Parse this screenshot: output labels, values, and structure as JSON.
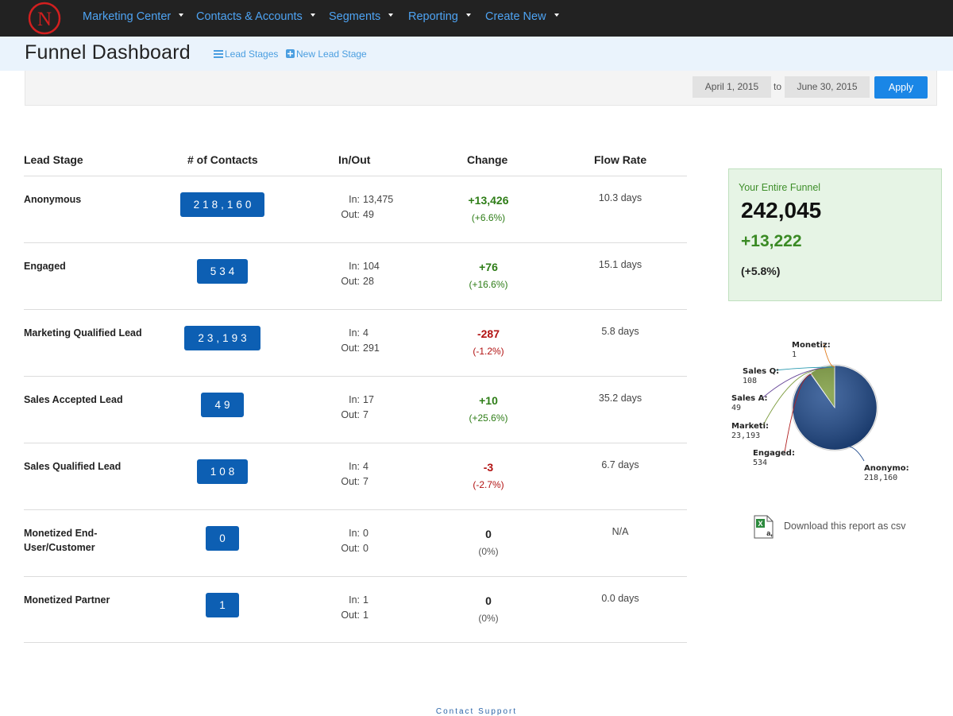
{
  "nav": {
    "logo_letter": "N",
    "items": [
      {
        "label": "Marketing Center"
      },
      {
        "label": "Contacts & Accounts"
      },
      {
        "label": "Segments"
      },
      {
        "label": "Reporting"
      },
      {
        "label": "Create New"
      }
    ]
  },
  "header": {
    "title": "Funnel Dashboard",
    "lead_stages_link": "Lead Stages",
    "new_lead_stage_link": "New Lead Stage"
  },
  "filter": {
    "start_date": "April 1, 2015",
    "to_label": "to",
    "end_date": "June 30, 2015",
    "apply_label": "Apply"
  },
  "table": {
    "headers": [
      "Lead Stage",
      "# of Contacts",
      "In/Out",
      "Change",
      "Flow Rate"
    ],
    "in_label": "In:",
    "out_label": "Out:",
    "rows": [
      {
        "stage": "Anonymous",
        "contacts": "218,160",
        "in": "13,475",
        "out": "49",
        "change": "+13,426",
        "change_pct": "(+6.6%)",
        "flow": "10.3 days",
        "trend": "pos"
      },
      {
        "stage": "Engaged",
        "contacts": "534",
        "in": "104",
        "out": "28",
        "change": "+76",
        "change_pct": "(+16.6%)",
        "flow": "15.1 days",
        "trend": "pos"
      },
      {
        "stage": "Marketing Qualified Lead",
        "contacts": "23,193",
        "in": "4",
        "out": "291",
        "change": "-287",
        "change_pct": "(-1.2%)",
        "flow": "5.8 days",
        "trend": "neg"
      },
      {
        "stage": "Sales Accepted Lead",
        "contacts": "49",
        "in": "17",
        "out": "7",
        "change": "+10",
        "change_pct": "(+25.6%)",
        "flow": "35.2 days",
        "trend": "pos"
      },
      {
        "stage": "Sales Qualified Lead",
        "contacts": "108",
        "in": "4",
        "out": "7",
        "change": "-3",
        "change_pct": "(-2.7%)",
        "flow": "6.7 days",
        "trend": "neg"
      },
      {
        "stage": "Monetized End-User/Customer",
        "contacts": "0",
        "in": "0",
        "out": "0",
        "change": "0",
        "change_pct": "(0%)",
        "flow": "N/A",
        "trend": "neu"
      },
      {
        "stage": "Monetized Partner",
        "contacts": "1",
        "in": "1",
        "out": "1",
        "change": "0",
        "change_pct": "(0%)",
        "flow": "0.0 days",
        "trend": "neu"
      }
    ]
  },
  "summary": {
    "label": "Your Entire Funnel",
    "total": "242,045",
    "change": "+13,222",
    "change_pct": "(+5.8%)"
  },
  "chart_data": {
    "type": "pie",
    "slices": [
      {
        "label": "Anonymo:",
        "value": 218160,
        "value_label": "218,160",
        "color": "#1f4a8c"
      },
      {
        "label": "Engaged:",
        "value": 534,
        "value_label": "534",
        "color": "#b01e1e"
      },
      {
        "label": "Marketi:",
        "value": 23193,
        "value_label": "23,193",
        "color": "#7a9a3a"
      },
      {
        "label": "Sales A:",
        "value": 49,
        "value_label": "49",
        "color": "#6a4a9a"
      },
      {
        "label": "Sales Q:",
        "value": 108,
        "value_label": "108",
        "color": "#2a9ab0"
      },
      {
        "label": "Monetiz:",
        "value": 1,
        "value_label": "1",
        "color": "#e07a1a"
      }
    ]
  },
  "download": {
    "label": "Download this report as csv"
  },
  "footer": {
    "contact_label": "Contact Support"
  },
  "colors": {
    "nav_bg": "#222222",
    "nav_link": "#4ea3f2",
    "count_badge": "#0d5fb3",
    "positive": "#2e7d17",
    "negative": "#b21212",
    "apply_button": "#1a86e6",
    "summary_bg": "#e6f4e5"
  }
}
